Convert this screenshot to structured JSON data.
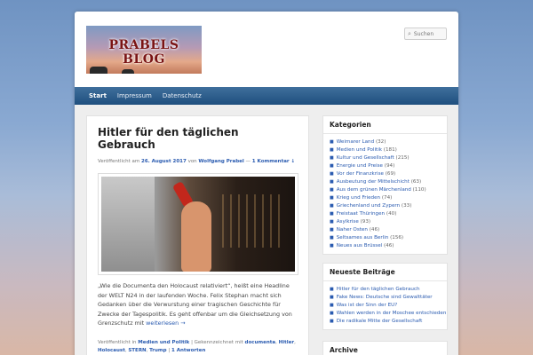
{
  "site": {
    "logo_text": "PRABELS BLOG",
    "search_placeholder": "Suchen"
  },
  "nav": {
    "items": [
      {
        "label": "Start",
        "active": true
      },
      {
        "label": "Impressum"
      },
      {
        "label": "Datenschutz"
      }
    ]
  },
  "post": {
    "title": "Hitler für den täglichen Gebrauch",
    "meta_prefix": "Veröffentlicht am",
    "date": "26. August 2017",
    "meta_by": "von",
    "author": "Wolfgang Prabel",
    "meta_sep": "—",
    "comments": "1 Kommentar ↓",
    "excerpt": "„Wie die Documenta den Holocaust relativiert“, heißt eine Headline der WELT N24 in der laufenden Woche. Felix Stephan macht sich Gedanken über die Verwurstung einer tragischen Geschichte für Zwecke der Tagespolitik. Es geht offenbar um die Gleichsetzung von Grenzschutz mit",
    "read_more": "weiterlesen →",
    "footer_prefix": "Veröffentlicht in",
    "category": "Medien und Politik",
    "footer_tagged": "| Gekennzeichnet mit",
    "tags": [
      "documenta",
      "Hitler",
      "Holocaust",
      "STERN",
      "Trump"
    ],
    "answers": "1 Antworten"
  },
  "sidebar": {
    "categories_title": "Kategorien",
    "categories": [
      {
        "name": "Weimarer Land",
        "count": "(32)"
      },
      {
        "name": "Medien und Politik",
        "count": "(181)"
      },
      {
        "name": "Kultur und Gesellschaft",
        "count": "(215)"
      },
      {
        "name": "Energie und Preise",
        "count": "(94)"
      },
      {
        "name": "Vor der Finanzkrise",
        "count": "(69)"
      },
      {
        "name": "Ausbeutung der Mittelschicht",
        "count": "(63)"
      },
      {
        "name": "Aus dem grünen Märchenland",
        "count": "(110)"
      },
      {
        "name": "Krieg und Frieden",
        "count": "(74)"
      },
      {
        "name": "Griechenland und Zypern",
        "count": "(33)"
      },
      {
        "name": "Freistaat Thüringen",
        "count": "(40)"
      },
      {
        "name": "Asylkrise",
        "count": "(93)"
      },
      {
        "name": "Naher Osten",
        "count": "(46)"
      },
      {
        "name": "Seltsames aus Berlin",
        "count": "(156)"
      },
      {
        "name": "Neues aus Brüssel",
        "count": "(46)"
      }
    ],
    "recent_title": "Neueste Beiträge",
    "recent": [
      "Hitler für den täglichen Gebrauch",
      "Fake News: Deutsche sind Gewalttäter",
      "Was ist der Sinn der EU?",
      "Wahlen werden in der Moschee entschieden",
      "Die radikale Mitte der Gesellschaft"
    ],
    "archive_title": "Archive"
  }
}
